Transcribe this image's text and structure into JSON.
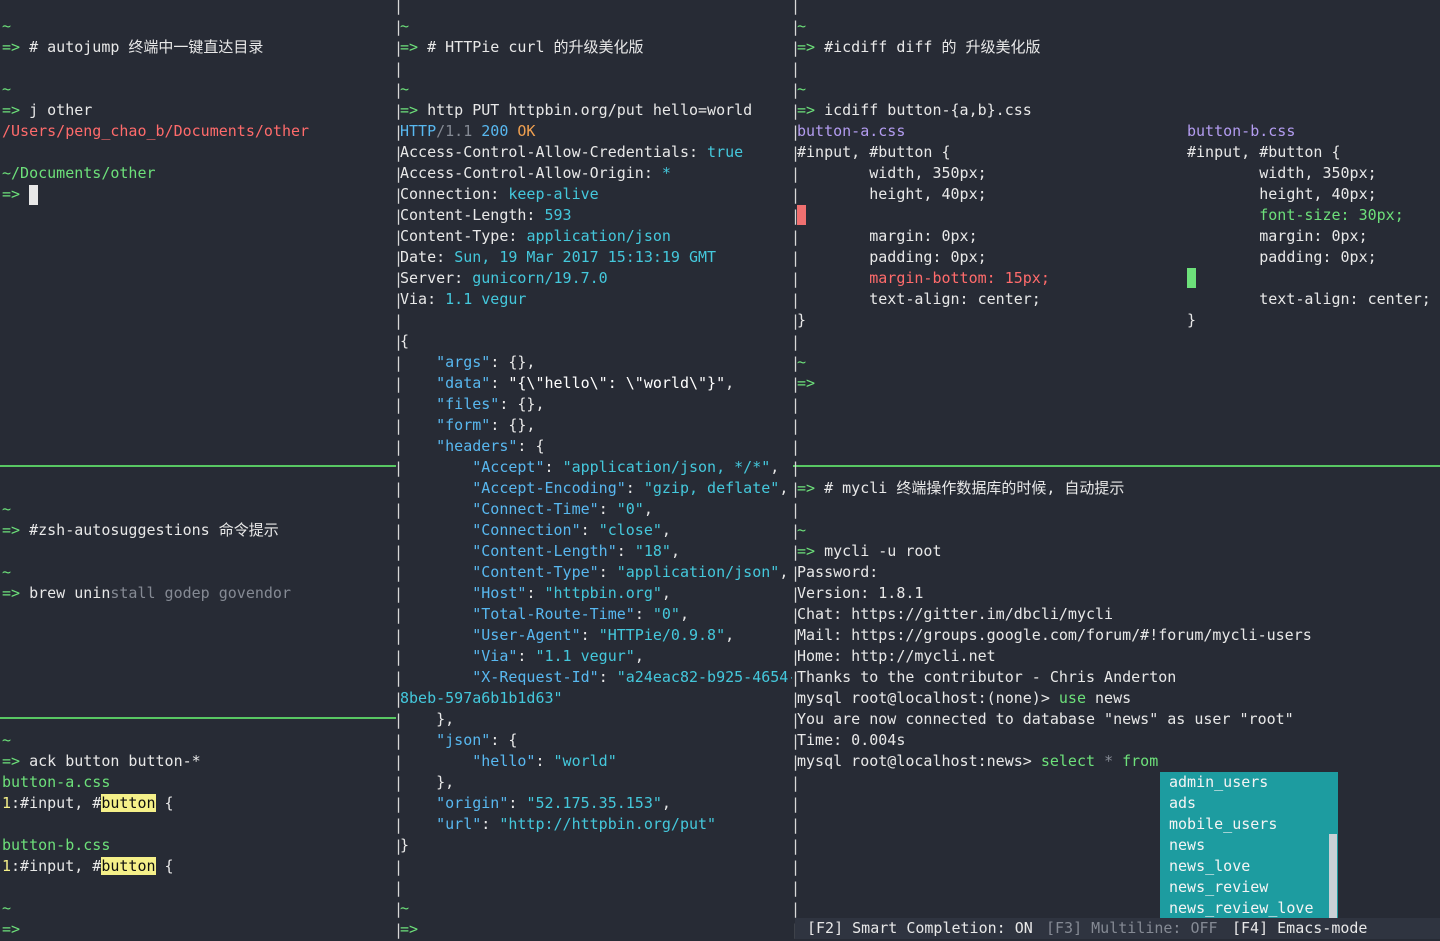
{
  "colors": {
    "background": "#272b35",
    "separator": "#58c763",
    "prompt_green": "#6de07a",
    "diff_removed": "#ff6b6b",
    "diff_added": "#6de07a",
    "completion_bg": "#1d9ca0"
  },
  "pane_autojump": {
    "lines": [
      [
        [
          "~",
          "c-green"
        ]
      ],
      [
        [
          "=> ",
          "c-green"
        ],
        [
          "# autojump 终端中一键直达目录",
          ""
        ]
      ],
      [],
      [
        [
          "~",
          "c-green"
        ]
      ],
      [
        [
          "=> ",
          "c-green"
        ],
        [
          "j other",
          ""
        ]
      ],
      [
        [
          "/Users/peng_chao_b/Documents/other",
          "c-red"
        ]
      ],
      [],
      [
        [
          "~/Documents/other",
          "c-green"
        ]
      ],
      [
        [
          "=> ",
          "c-green"
        ]
      ]
    ]
  },
  "pane_autosuggest": {
    "lines": [
      [],
      [
        [
          "~",
          "c-green"
        ]
      ],
      [
        [
          "=> ",
          "c-green"
        ],
        [
          "#zsh-autosuggestions 命令提示",
          ""
        ]
      ],
      [],
      [
        [
          "~",
          "c-green"
        ]
      ],
      [
        [
          "=> ",
          "c-green"
        ],
        [
          "brew unin",
          ""
        ],
        [
          "stall godep govendor",
          "c-grey"
        ]
      ]
    ]
  },
  "pane_ack": {
    "lines": [
      [
        [
          "~",
          "c-green"
        ]
      ],
      [
        [
          "=> ",
          "c-green"
        ],
        [
          "ack button button-*",
          ""
        ]
      ],
      [
        [
          "button-a.css",
          "c-green"
        ]
      ],
      [
        [
          "1",
          "c-yellow"
        ],
        [
          ":#input, #",
          ""
        ],
        [
          "button",
          "c-yellowbg"
        ],
        [
          " {",
          ""
        ]
      ],
      [],
      [
        [
          "button-b.css",
          "c-green"
        ]
      ],
      [
        [
          "1",
          "c-yellow"
        ],
        [
          ":#input, #",
          ""
        ],
        [
          "button",
          "c-yellowbg"
        ],
        [
          " {",
          ""
        ]
      ],
      [],
      [
        [
          "~",
          "c-green"
        ]
      ],
      [
        [
          "=>",
          "c-green"
        ]
      ]
    ]
  },
  "pane_httpie": {
    "lines": [
      [
        [
          "~",
          "c-green"
        ]
      ],
      [
        [
          "=> ",
          "c-green"
        ],
        [
          "# HTTPie curl 的升级美化版",
          ""
        ]
      ],
      [],
      [
        [
          "~",
          "c-green"
        ]
      ],
      [
        [
          "=> ",
          "c-green"
        ],
        [
          "http PUT httpbin.org/put hello=world",
          ""
        ]
      ],
      [
        [
          "HTTP",
          "c-blue"
        ],
        [
          "/1.1 ",
          "c-grey"
        ],
        [
          "200 ",
          "c-blue"
        ],
        [
          "OK",
          "c-orange"
        ]
      ],
      [
        [
          "Access-Control-Allow-Credentials: ",
          ""
        ],
        [
          "true",
          "c-cyan"
        ]
      ],
      [
        [
          "Access-Control-Allow-Origin: ",
          ""
        ],
        [
          "*",
          "c-cyan"
        ]
      ],
      [
        [
          "Connection: ",
          ""
        ],
        [
          "keep-alive",
          "c-cyan"
        ]
      ],
      [
        [
          "Content-Length: ",
          ""
        ],
        [
          "593",
          "c-cyan"
        ]
      ],
      [
        [
          "Content-Type: ",
          ""
        ],
        [
          "application/json",
          "c-cyan"
        ]
      ],
      [
        [
          "Date: ",
          ""
        ],
        [
          "Sun, 19 Mar 2017 15:13:19 GMT",
          "c-cyan"
        ]
      ],
      [
        [
          "Server: ",
          ""
        ],
        [
          "gunicorn/19.7.0",
          "c-cyan"
        ]
      ],
      [
        [
          "Via: ",
          ""
        ],
        [
          "1.1 vegur",
          "c-cyan"
        ]
      ],
      [],
      [
        [
          "{",
          ""
        ]
      ],
      [
        [
          "    ",
          ""
        ],
        [
          "\"args\"",
          "c-blue"
        ],
        [
          ": {},",
          ""
        ]
      ],
      [
        [
          "    ",
          ""
        ],
        [
          "\"data\"",
          "c-blue"
        ],
        [
          ": ",
          ""
        ],
        [
          "\"{\\\"hello\\\": \\\"world\\\"}\"",
          "c-bright"
        ],
        [
          ",",
          ""
        ]
      ],
      [
        [
          "    ",
          ""
        ],
        [
          "\"files\"",
          "c-blue"
        ],
        [
          ": {},",
          ""
        ]
      ],
      [
        [
          "    ",
          ""
        ],
        [
          "\"form\"",
          "c-blue"
        ],
        [
          ": {},",
          ""
        ]
      ],
      [
        [
          "    ",
          ""
        ],
        [
          "\"headers\"",
          "c-blue"
        ],
        [
          ": {",
          ""
        ]
      ],
      [
        [
          "        ",
          ""
        ],
        [
          "\"Accept\"",
          "c-blue"
        ],
        [
          ": ",
          ""
        ],
        [
          "\"application/json, */*\"",
          "c-cyan"
        ],
        [
          ",",
          ""
        ]
      ],
      [
        [
          "        ",
          ""
        ],
        [
          "\"Accept-Encoding\"",
          "c-blue"
        ],
        [
          ": ",
          ""
        ],
        [
          "\"gzip, deflate\"",
          "c-cyan"
        ],
        [
          ",",
          ""
        ]
      ],
      [
        [
          "        ",
          ""
        ],
        [
          "\"Connect-Time\"",
          "c-blue"
        ],
        [
          ": ",
          ""
        ],
        [
          "\"0\"",
          "c-cyan"
        ],
        [
          ",",
          ""
        ]
      ],
      [
        [
          "        ",
          ""
        ],
        [
          "\"Connection\"",
          "c-blue"
        ],
        [
          ": ",
          ""
        ],
        [
          "\"close\"",
          "c-cyan"
        ],
        [
          ",",
          ""
        ]
      ],
      [
        [
          "        ",
          ""
        ],
        [
          "\"Content-Length\"",
          "c-blue"
        ],
        [
          ": ",
          ""
        ],
        [
          "\"18\"",
          "c-cyan"
        ],
        [
          ",",
          ""
        ]
      ],
      [
        [
          "        ",
          ""
        ],
        [
          "\"Content-Type\"",
          "c-blue"
        ],
        [
          ": ",
          ""
        ],
        [
          "\"application/json\"",
          "c-cyan"
        ],
        [
          ",",
          ""
        ]
      ],
      [
        [
          "        ",
          ""
        ],
        [
          "\"Host\"",
          "c-blue"
        ],
        [
          ": ",
          ""
        ],
        [
          "\"httpbin.org\"",
          "c-cyan"
        ],
        [
          ",",
          ""
        ]
      ],
      [
        [
          "        ",
          ""
        ],
        [
          "\"Total-Route-Time\"",
          "c-blue"
        ],
        [
          ": ",
          ""
        ],
        [
          "\"0\"",
          "c-cyan"
        ],
        [
          ",",
          ""
        ]
      ],
      [
        [
          "        ",
          ""
        ],
        [
          "\"User-Agent\"",
          "c-blue"
        ],
        [
          ": ",
          ""
        ],
        [
          "\"HTTPie/0.9.8\"",
          "c-cyan"
        ],
        [
          ",",
          ""
        ]
      ],
      [
        [
          "        ",
          ""
        ],
        [
          "\"Via\"",
          "c-blue"
        ],
        [
          ": ",
          ""
        ],
        [
          "\"1.1 vegur\"",
          "c-cyan"
        ],
        [
          ",",
          ""
        ]
      ],
      [
        [
          "        ",
          ""
        ],
        [
          "\"X-Request-Id\"",
          "c-blue"
        ],
        [
          ": ",
          ""
        ],
        [
          "\"a24eac82-b925-4654-",
          "c-cyan"
        ]
      ],
      [
        [
          "8beb-597a6b1b1d63\"",
          "c-cyan"
        ]
      ],
      [
        [
          "    },",
          ""
        ]
      ],
      [
        [
          "    ",
          ""
        ],
        [
          "\"json\"",
          "c-blue"
        ],
        [
          ": {",
          ""
        ]
      ],
      [
        [
          "        ",
          ""
        ],
        [
          "\"hello\"",
          "c-blue"
        ],
        [
          ": ",
          ""
        ],
        [
          "\"world\"",
          "c-cyan"
        ]
      ],
      [
        [
          "    },",
          ""
        ]
      ],
      [
        [
          "    ",
          ""
        ],
        [
          "\"origin\"",
          "c-blue"
        ],
        [
          ": ",
          ""
        ],
        [
          "\"52.175.35.153\"",
          "c-cyan"
        ],
        [
          ",",
          ""
        ]
      ],
      [
        [
          "    ",
          ""
        ],
        [
          "\"url\"",
          "c-blue"
        ],
        [
          ": ",
          ""
        ],
        [
          "\"http://httpbin.org/put\"",
          "c-cyan"
        ]
      ],
      [
        [
          "}",
          ""
        ]
      ],
      [],
      [],
      [
        [
          "~",
          "c-green"
        ]
      ],
      [
        [
          "=>",
          "c-green"
        ]
      ]
    ]
  },
  "pane_icdiff": {
    "left_lines": [
      [
        [
          "~",
          "c-green"
        ]
      ],
      [
        [
          "=> ",
          "c-green"
        ],
        [
          "#icdiff diff 的 升级美化版",
          ""
        ]
      ],
      [],
      [
        [
          "~",
          "c-green"
        ]
      ],
      [
        [
          "=> ",
          "c-green"
        ],
        [
          "icdiff button-{a,b}.css",
          ""
        ]
      ],
      [
        [
          "button-a.css",
          "c-violet"
        ]
      ],
      [
        [
          "#input, #button {",
          ""
        ]
      ],
      [
        [
          "        width, 350px;",
          ""
        ]
      ],
      [
        [
          "        height, 40px;",
          ""
        ]
      ],
      [],
      [
        [
          "        margin: 0px;",
          ""
        ]
      ],
      [
        [
          "        padding: 0px;",
          ""
        ]
      ],
      [
        [
          "        ",
          ""
        ],
        [
          "margin-bottom: 15px;",
          "c-red"
        ]
      ],
      [
        [
          "        text-align: center;",
          ""
        ]
      ],
      [
        [
          "}",
          ""
        ]
      ],
      [],
      [
        [
          "~",
          "c-green"
        ]
      ],
      [
        [
          "=>",
          "c-green"
        ]
      ]
    ],
    "right_lines": [
      [],
      [],
      [],
      [],
      [],
      [
        [
          "button-b.css",
          "c-violet"
        ]
      ],
      [
        [
          "#input, #button {",
          ""
        ]
      ],
      [
        [
          "        width, 350px;",
          ""
        ]
      ],
      [
        [
          "        height, 40px;",
          ""
        ]
      ],
      [
        [
          "        ",
          ""
        ],
        [
          "font-size: 30px;",
          "c-green"
        ]
      ],
      [
        [
          "        margin: 0px;",
          ""
        ]
      ],
      [
        [
          "        padding: 0px;",
          ""
        ]
      ],
      [],
      [
        [
          "        text-align: center;",
          ""
        ]
      ],
      [
        [
          "}",
          ""
        ]
      ]
    ]
  },
  "pane_mycli": {
    "lines": [
      [
        [
          "=> ",
          "c-green"
        ],
        [
          "# mycli 终端操作数据库的时候, 自动提示",
          ""
        ]
      ],
      [],
      [
        [
          "~",
          "c-green"
        ]
      ],
      [
        [
          "=> ",
          "c-green"
        ],
        [
          "mycli -u root",
          ""
        ]
      ],
      [
        [
          "Password:",
          ""
        ]
      ],
      [
        [
          "Version: 1.8.1",
          ""
        ]
      ],
      [
        [
          "Chat: https://gitter.im/dbcli/mycli",
          ""
        ]
      ],
      [
        [
          "Mail: https://groups.google.com/forum/#!forum/mycli-users",
          ""
        ]
      ],
      [
        [
          "Home: http://mycli.net",
          ""
        ]
      ],
      [
        [
          "Thanks to the contributor - Chris Anderton",
          ""
        ]
      ],
      [
        [
          "mysql root@localhost:(none)> ",
          ""
        ],
        [
          "use",
          "c-green"
        ],
        [
          " news",
          ""
        ]
      ],
      [
        [
          "You are now connected to database \"news\" as user \"root\"",
          ""
        ]
      ],
      [
        [
          "Time: 0.004s",
          ""
        ]
      ],
      [
        [
          "mysql root@localhost:news> ",
          ""
        ],
        [
          "select",
          "c-green"
        ],
        [
          " ",
          ""
        ],
        [
          "*",
          "c-grey"
        ],
        [
          " ",
          ""
        ],
        [
          "from",
          "c-green"
        ]
      ]
    ],
    "completions": [
      "admin_users",
      "ads",
      "mobile_users",
      "news",
      "news_love",
      "news_review",
      "news_review_love"
    ],
    "status": {
      "f2": "[F2] Smart Completion: ON",
      "f3": "[F3] Multiline: OFF",
      "f4": "[F4] Emacs-mode"
    }
  }
}
